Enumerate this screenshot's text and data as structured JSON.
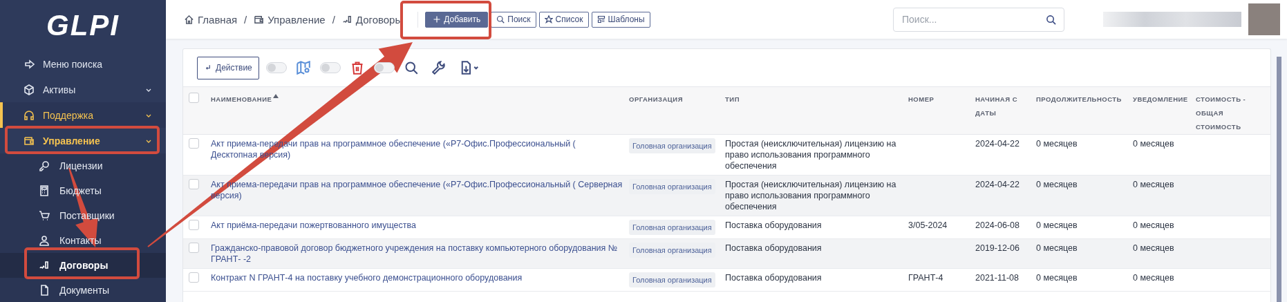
{
  "logo": {
    "text": "GLPI"
  },
  "sidebar": {
    "items": [
      {
        "label": "Меню поиска",
        "selected": false,
        "expanded": false,
        "has_children": false
      },
      {
        "label": "Активы",
        "selected": false,
        "expanded": false,
        "has_children": true
      },
      {
        "label": "Поддержка",
        "selected": true,
        "expanded": false,
        "has_children": true
      },
      {
        "label": "Управление",
        "selected": false,
        "expanded": true,
        "has_children": true,
        "children": [
          {
            "label": "Лицензии",
            "selected": false
          },
          {
            "label": "Бюджеты",
            "selected": false
          },
          {
            "label": "Поставщики",
            "selected": false
          },
          {
            "label": "Контакты",
            "selected": false
          },
          {
            "label": "Договоры",
            "selected": true
          },
          {
            "label": "Документы",
            "selected": false
          }
        ]
      }
    ]
  },
  "breadcrumb": {
    "items": [
      "Главная",
      "Управление",
      "Договоры"
    ],
    "separator": "/"
  },
  "header_buttons": [
    {
      "label": "Добавить",
      "kind": "primary"
    },
    {
      "label": "Поиск",
      "kind": "outline"
    },
    {
      "label": "Список",
      "kind": "outline"
    },
    {
      "label": "Шаблоны",
      "kind": "outline"
    }
  ],
  "search": {
    "placeholder": "Поиск..."
  },
  "toolbar": {
    "action_label": "Действие",
    "toggles": [
      {
        "on": false
      },
      {
        "on": false
      },
      {
        "on": false
      }
    ]
  },
  "table": {
    "header_checked": false,
    "columns": [
      {
        "label": "НАИМЕНОВАНИЕ",
        "sorted": true
      },
      {
        "label": "ОРГАНИЗАЦИЯ",
        "sorted": false
      },
      {
        "label": "ТИП",
        "sorted": false
      },
      {
        "label": "НОМЕР",
        "sorted": false
      },
      {
        "label": "НАЧИНАЯ С ДАТЫ",
        "sorted": false
      },
      {
        "label": "ПРОДОЛЖИТЕЛЬНОСТЬ",
        "sorted": false
      },
      {
        "label": "УВЕДОМЛЕНИЕ",
        "sorted": false
      },
      {
        "label": "СТОИМОСТЬ - ОБЩАЯ СТОИМОСТЬ",
        "sorted": false
      }
    ],
    "rows": [
      {
        "checked": false,
        "name": "Акт приема-передачи прав на программное обеспечение («Р7-Офис.Профессиональный ( Десктопная версия)",
        "organization": "Головная организация",
        "type": "Простая (неисключительная) лицензию на право использования программного обеспечения",
        "number": "",
        "start_date": "2024-04-22",
        "duration": "0 месяцев",
        "notice": "0 месяцев"
      },
      {
        "checked": false,
        "name": "Акт приема-передачи прав на программное обеспечение («Р7-Офис.Профессиональный ( Серверная версия)",
        "organization": "Головная организация",
        "type": "Простая (неисключительная) лицензию на право использования программного обеспечения",
        "number": "",
        "start_date": "2024-04-22",
        "duration": "0 месяцев",
        "notice": "0 месяцев"
      },
      {
        "checked": false,
        "name": "Акт приёма-передачи пожертвованного имущества",
        "organization": "Головная организация",
        "type": "Поставка оборудования",
        "number": "3/05-2024",
        "start_date": "2024-06-08",
        "duration": "0 месяцев",
        "notice": "0 месяцев"
      },
      {
        "checked": false,
        "name": "Гражданско-правовой договор бюджетного учреждения на поставку компьютерного оборудования № ГРАНТ- -2",
        "organization": "Головная организация",
        "type": "Поставка оборудования",
        "number": "",
        "start_date": "2019-12-06",
        "duration": "0 месяцев",
        "notice": "0 месяцев"
      },
      {
        "checked": false,
        "name": "Контракт N ГРАНТ-4 на поставку учебного демонстрационного оборудования",
        "organization": "Головная организация",
        "type": "Поставка оборудования",
        "number": "ГРАНТ-4",
        "start_date": "2021-11-08",
        "duration": "0 месяцев",
        "notice": "0 месяцев"
      }
    ]
  }
}
